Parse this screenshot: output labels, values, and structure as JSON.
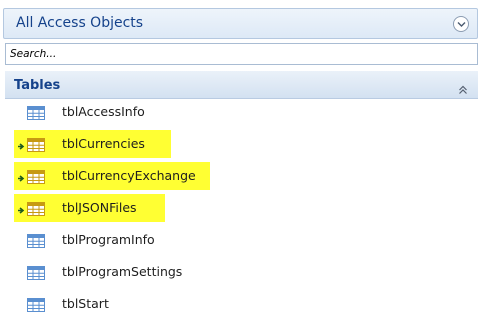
{
  "pane": {
    "title": "All Access Objects",
    "search_placeholder": "Search...",
    "group_title": "Tables"
  },
  "items": [
    {
      "label": "tblAccessInfo",
      "highlighted": false,
      "linked": false
    },
    {
      "label": "tblCurrencies",
      "highlighted": true,
      "linked": true
    },
    {
      "label": "tblCurrencyExchange",
      "highlighted": true,
      "linked": true
    },
    {
      "label": "tblJSONFiles",
      "highlighted": true,
      "linked": true
    },
    {
      "label": "tblProgramInfo",
      "highlighted": false,
      "linked": false
    },
    {
      "label": "tblProgramSettings",
      "highlighted": false,
      "linked": false
    },
    {
      "label": "tblStart",
      "highlighted": false,
      "linked": false
    }
  ],
  "colors": {
    "highlight": "#ffff33",
    "header_text": "#15428b",
    "table_icon": "#5a8fd0"
  },
  "icons": {
    "table": "table-icon",
    "linked_table": "linked-table-icon",
    "menu": "chevron-down-circle-icon",
    "collapse": "double-chevron-up-icon"
  }
}
